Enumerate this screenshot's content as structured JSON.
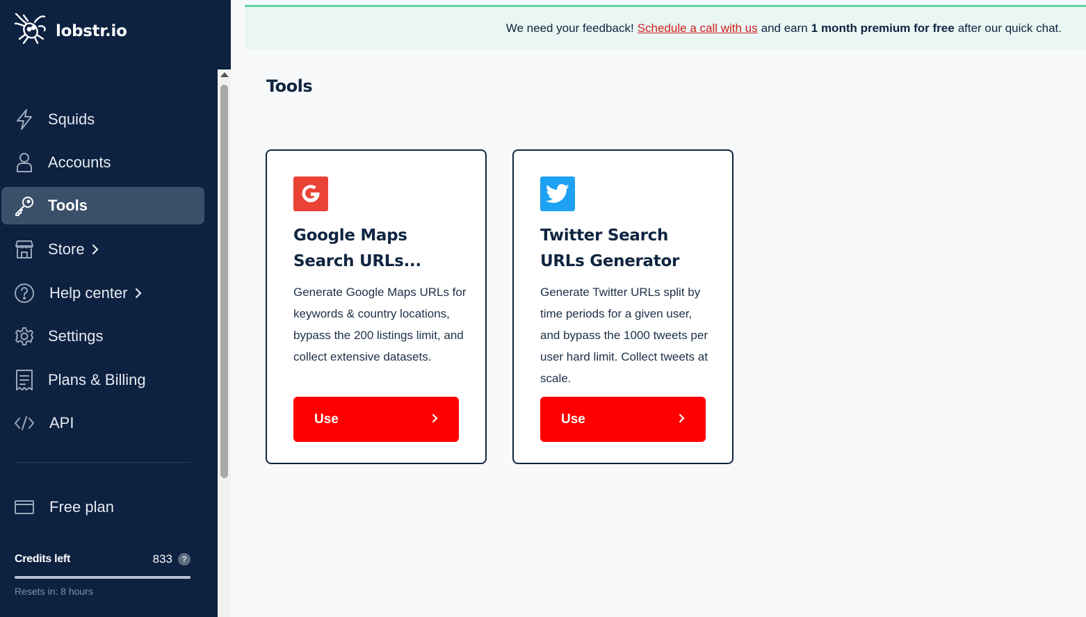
{
  "app": {
    "logo_text": "lobstr.io"
  },
  "sidebar": {
    "items": [
      {
        "label": "Squids",
        "icon": "lightning-icon"
      },
      {
        "label": "Accounts",
        "icon": "user-icon"
      },
      {
        "label": "Tools",
        "icon": "key-icon",
        "active": true
      },
      {
        "label": "Store",
        "icon": "store-icon",
        "has_chevron": true
      },
      {
        "label": "Help center",
        "icon": "help-circle-icon",
        "has_chevron": true
      },
      {
        "label": "Settings",
        "icon": "gear-icon"
      },
      {
        "label": "Plans & Billing",
        "icon": "receipt-icon"
      },
      {
        "label": "API",
        "icon": "code-icon"
      }
    ],
    "plan": {
      "label": "Free plan",
      "icon": "credit-card-icon"
    },
    "credits": {
      "label": "Credits left",
      "value": "833",
      "help": "?",
      "fill_fraction": 1.0
    },
    "resets": "Resets in: 8 hours"
  },
  "banner": {
    "prefix": "We need your feedback!",
    "link": "Schedule a call with us",
    "middle": "and earn",
    "bold": "1 month premium for free",
    "suffix": "after our quick chat."
  },
  "main": {
    "title": "Tools",
    "cards": [
      {
        "title": "Google Maps Search URLs...",
        "description": "Generate Google Maps URLs for keywords & country locations, bypass the 200 listings limit, and collect extensive datasets.",
        "button": "Use",
        "icon": "google-icon",
        "icon_color": "#ea4335"
      },
      {
        "title": "Twitter Search URLs Generator",
        "description": "Generate Twitter URLs split by time periods for a given user, and bypass the 1000 tweets per user hard limit. Collect tweets at scale.",
        "button": "Use",
        "icon": "twitter-icon",
        "icon_color": "#1da1f2"
      }
    ]
  },
  "colors": {
    "sidebar_bg": "#0d2140",
    "accent_red": "#ff0000",
    "banner_border": "#5fd39f"
  }
}
